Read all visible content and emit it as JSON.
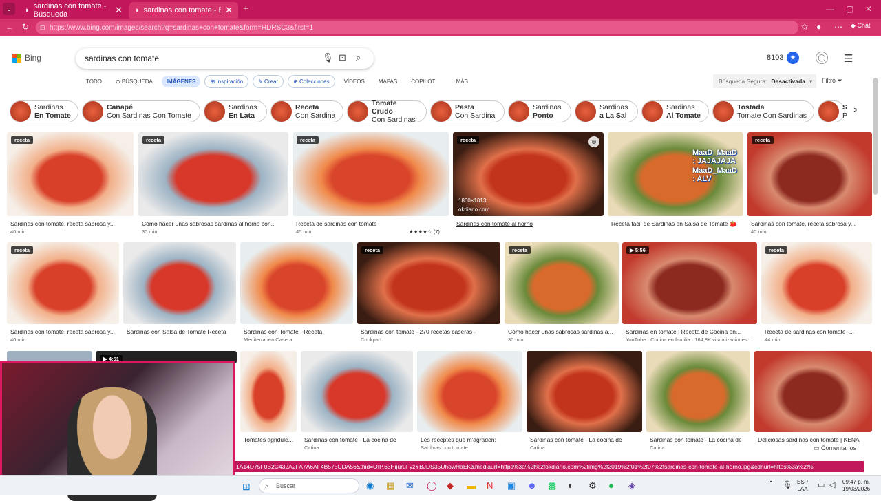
{
  "browser": {
    "tabs": [
      {
        "label": "sardinas con tomate - Búsqueda"
      },
      {
        "label": "sardinas con tomate - Búsqueda d"
      }
    ],
    "new_tab_icon": "plus-icon",
    "url": "https://www.bing.com/images/search?q=sardinas+con+tomate&form=HDRSC3&first=1",
    "chat_label": "Chat"
  },
  "bing": {
    "logo": "Bing",
    "query": "sardinas con tomate",
    "points": "8103",
    "nav": [
      {
        "label": "TODO"
      },
      {
        "label": "BÚSQUEDA"
      },
      {
        "label": "IMÁGENES"
      },
      {
        "label": "Inspiración"
      },
      {
        "label": "Crear"
      },
      {
        "label": "Colecciones"
      },
      {
        "label": "VÍDEOS"
      },
      {
        "label": "MAPAS"
      },
      {
        "label": "COPILOT"
      },
      {
        "label": "MÁS"
      }
    ],
    "safe_search_label": "Búsqueda Segura:",
    "safe_search_value": "Desactivada",
    "filter_label": "Filtro"
  },
  "chips": [
    {
      "top": "Sardinas",
      "bottom": "En Tomate",
      "bold": "bottom"
    },
    {
      "top": "Canapé",
      "bottom": "Con Sardinas Con Tomate",
      "bold": "top"
    },
    {
      "top": "Sardinas",
      "bottom": "En Lata",
      "bold": "bottom"
    },
    {
      "top": "Receta",
      "bottom": "Con Sardina",
      "bold": "top"
    },
    {
      "top": "Tomate Crudo",
      "bottom": "Con Sardinas",
      "bold": "top"
    },
    {
      "top": "Pasta",
      "bottom": "Con Sardina",
      "bold": "top"
    },
    {
      "top": "Sardinas",
      "bottom": "Ponto",
      "bold": "bottom"
    },
    {
      "top": "Sardinas",
      "bottom": "a La Sal",
      "bold": "bottom"
    },
    {
      "top": "Sardinas",
      "bottom": "Al Tomate",
      "bold": "bottom"
    },
    {
      "top": "Tostada",
      "bottom": "Tomate Con Sardinas",
      "bold": "top"
    },
    {
      "top": "S",
      "bottom": "P",
      "bold": "top"
    }
  ],
  "row1": [
    {
      "badge": "receta",
      "caption": "Sardinas con tomate, receta sabrosa y...",
      "sub": "40 min"
    },
    {
      "badge": "receta",
      "caption": "Cómo hacer unas sabrosas sardinas al horno con...",
      "sub": "30 min"
    },
    {
      "badge": "receta",
      "caption": "Receta de sardinas con tomate",
      "sub": "45 min",
      "rating": "★★★★☆ (7)"
    },
    {
      "badge": "receta",
      "caption": "Sardinas con tomate al horno",
      "sub": "",
      "dims": "1800×1013",
      "source": "okdiario.com"
    },
    {
      "badge": "",
      "caption": "Receta fácil de Sardinas en Salsa de Tomate 🍅",
      "sub": ""
    },
    {
      "badge": "receta",
      "caption": "Sardinas con tomate, receta sabrosa y...",
      "sub": "40 min"
    }
  ],
  "row2": [
    {
      "badge": "receta",
      "caption": "Sardinas con tomate, receta sabrosa y...",
      "sub": "40 min"
    },
    {
      "badge": "",
      "caption": "Sardinas con Salsa de Tomate Receta",
      "sub": ""
    },
    {
      "badge": "",
      "caption": "Sardinas con Tomate - Receta",
      "sub": "Mediterranea Casera"
    },
    {
      "badge": "receta",
      "caption": "Sardinas con tomate - 270 recetas caseras -",
      "sub": "Cookpad"
    },
    {
      "badge": "receta",
      "caption": "Cómo hacer unas sabrosas sardinas a...",
      "sub": "30 min"
    },
    {
      "badge": "▶ 5:56",
      "caption": "Sardinas en tomate | Receta de Cocina en...",
      "sub": "YouTube · Cocina en familia · 164,8K visualizaciones · 2..."
    },
    {
      "badge": "receta",
      "caption": "Receta de sardinas con tomate -...",
      "sub": "44 min"
    }
  ],
  "row3": [
    {
      "caption": "Tomates agridulces con s...",
      "sub": ""
    },
    {
      "caption": "Sardinas con tomate - La cocina de",
      "sub": "Catina"
    },
    {
      "caption": "Les receptes que m'agraden:",
      "sub": "Sardinas con tomate"
    },
    {
      "caption": "Sardinas con tomate - La cocina de",
      "sub": "Catina"
    },
    {
      "caption": "Sardinas con tomate - La cocina de",
      "sub": "Catina"
    },
    {
      "caption": "Deliciosas sardinas con tomate | KENA",
      "sub": ""
    }
  ],
  "video_badge": "▶ 4:51",
  "overlay_text": [
    "MaaD_MaaD : JAJAJAJA",
    "MaaD_MaaD : ALV"
  ],
  "comments_label": "Comentarios",
  "status_url": "1A14D75F0B2C432A2FA7A6AF4B575CDA56&thid=OIP.63HijuruFyzYBJDS35UhowHaEK&mediaurl=https%3a%2f%2fokdiario.com%2fimg%2f2019%2f01%2f07%2fsardinas-con-tomate-al-horno.jpg&cdnurl=https%3a%2f%",
  "taskbar": {
    "search_placeholder": "Buscar",
    "lang": "ESP",
    "lang2": "LAA",
    "time": "09:47 p. m.",
    "date": "19/03/2026"
  },
  "colors": {
    "browser_accent": "#c2185b",
    "bing_blue": "#1a4fb0"
  }
}
